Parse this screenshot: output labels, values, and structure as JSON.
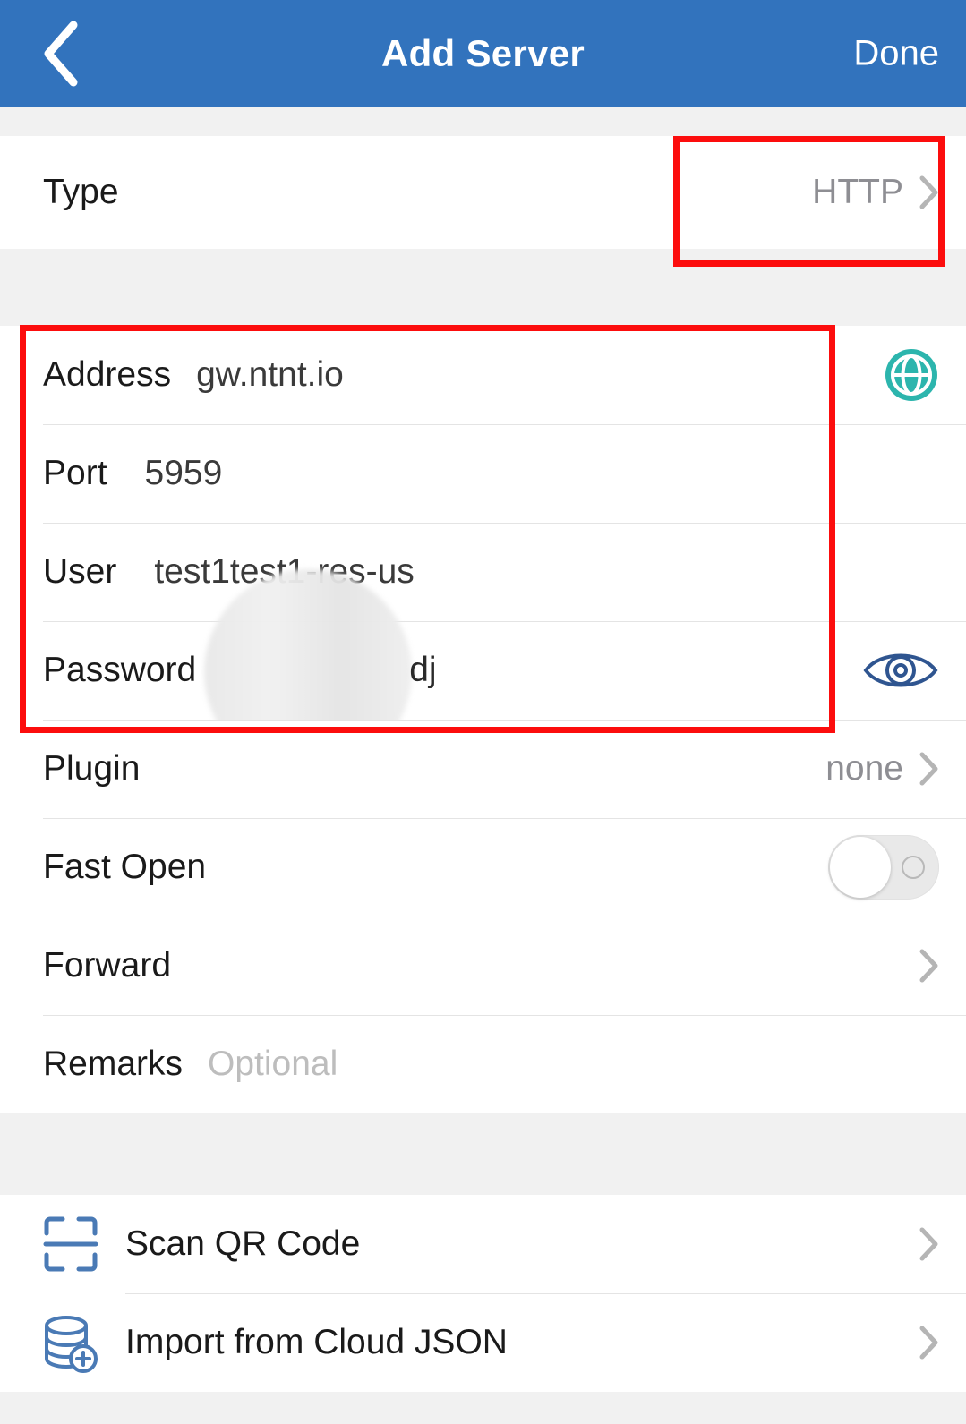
{
  "navbar": {
    "back_icon": "chevron-left-icon",
    "title": "Add Server",
    "done_label": "Done"
  },
  "sections": {
    "type": {
      "label": "Type",
      "value": "HTTP",
      "chevron": "chevron-right-icon"
    },
    "credentials": [
      {
        "label": "Address",
        "value": "gw.ntnt.io",
        "accessory": "globe-icon"
      },
      {
        "label": "Port",
        "value": "5959",
        "accessory": "none"
      },
      {
        "label": "User",
        "value": "test1test1-res-us",
        "accessory": "none"
      },
      {
        "label": "Password",
        "value": "dj",
        "accessory": "eye-icon",
        "redacted": true
      }
    ],
    "options": {
      "plugin": {
        "label": "Plugin",
        "value": "none",
        "chevron": "chevron-right-icon"
      },
      "fast_open": {
        "label": "Fast Open",
        "toggle_state": "off"
      },
      "forward": {
        "label": "Forward",
        "chevron": "chevron-right-icon"
      },
      "remarks": {
        "label": "Remarks",
        "placeholder": "Optional",
        "value": ""
      }
    },
    "import": [
      {
        "label": "Scan QR Code",
        "icon": "qr-scan-icon",
        "chevron": "chevron-right-icon"
      },
      {
        "label": "Import from Cloud JSON",
        "icon": "database-add-icon",
        "chevron": "chevron-right-icon"
      }
    ]
  },
  "annotations": [
    {
      "name": "type-value-highlight",
      "color": "#fc0d0d"
    },
    {
      "name": "credentials-highlight",
      "color": "#fc0d0d"
    }
  ],
  "colors": {
    "navbar_blue": "#3273bd",
    "globe_teal": "#2cb5ad",
    "eye_blue": "#2f5590",
    "icon_blue": "#4a7ab5",
    "annotation_red": "#fc0d0d",
    "background_gray": "#f1f1f1"
  }
}
